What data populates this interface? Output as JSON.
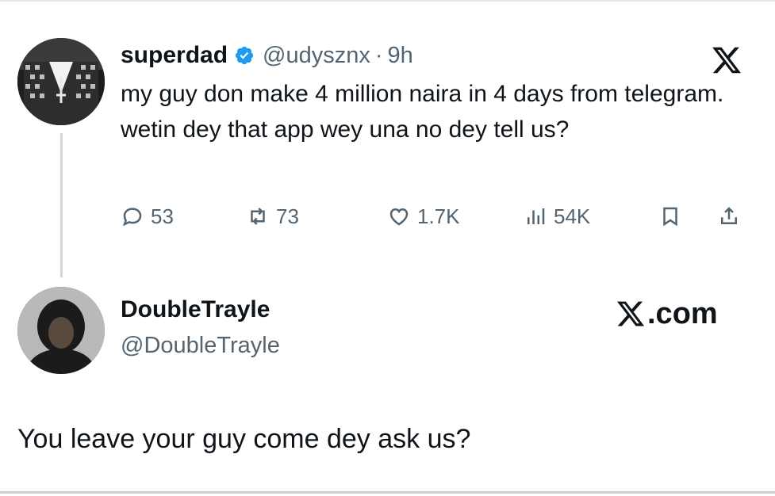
{
  "tweet": {
    "author_name": "superdad",
    "author_handle": "@udysznx",
    "separator": "·",
    "time": "9h",
    "text": "my guy don make 4 million naira in 4 days from telegram. wetin dey that app wey una no dey tell us?",
    "stats": {
      "replies": "53",
      "reposts": "73",
      "likes": "1.7K",
      "views": "54K"
    }
  },
  "card": {
    "name": "DoubleTrayle",
    "handle": "@DoubleTrayle",
    "domain_text": ".com"
  },
  "reply_text": "You leave your guy come dey ask us?",
  "colors": {
    "text": "#0f1419",
    "muted": "#536471",
    "verified": "#1d9bf0",
    "thread_line": "#cfd9de"
  },
  "icons": [
    "verified-badge-icon",
    "x-logo-icon",
    "reply-icon",
    "repost-icon",
    "like-icon",
    "views-icon",
    "bookmark-icon",
    "share-icon"
  ]
}
